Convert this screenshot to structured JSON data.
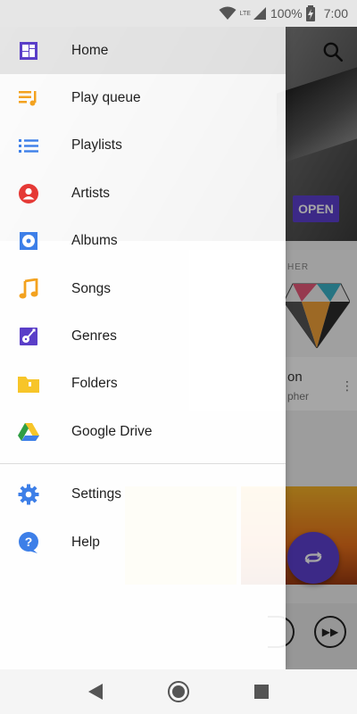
{
  "status_bar": {
    "network": "LTE",
    "battery": "100%",
    "time": "7:00"
  },
  "drawer": {
    "items": [
      {
        "label": "Home",
        "icon": "home-icon",
        "active": true,
        "color": "#5a3ec8"
      },
      {
        "label": "Play queue",
        "icon": "play-queue-icon",
        "active": false,
        "color": "#f3a21f"
      },
      {
        "label": "Playlists",
        "icon": "playlists-icon",
        "active": false,
        "color": "#3d7fe8"
      },
      {
        "label": "Artists",
        "icon": "artist-icon",
        "active": false,
        "color": "#e53935"
      },
      {
        "label": "Albums",
        "icon": "album-icon",
        "active": false,
        "color": "#3d7fe8"
      },
      {
        "label": "Songs",
        "icon": "music-note-icon",
        "active": false,
        "color": "#f3a21f"
      },
      {
        "label": "Genres",
        "icon": "guitar-icon",
        "active": false,
        "color": "#5a3ec8"
      },
      {
        "label": "Folders",
        "icon": "folder-icon",
        "active": false,
        "color": "#f7c529"
      },
      {
        "label": "Google Drive",
        "icon": "google-drive-icon",
        "active": false,
        "color": "#2f9e44"
      }
    ],
    "secondary": [
      {
        "label": "Settings",
        "icon": "gear-icon",
        "color": "#3d7fe8"
      },
      {
        "label": "Help",
        "icon": "help-icon",
        "color": "#3d7fe8"
      }
    ]
  },
  "background": {
    "open_button": "OPEN",
    "card_tag": "HER",
    "card_title": "on",
    "card_subtitle": "pher"
  },
  "nav_bar": {
    "back": "back-icon",
    "home": "home-circle-icon",
    "recents": "recents-icon"
  }
}
